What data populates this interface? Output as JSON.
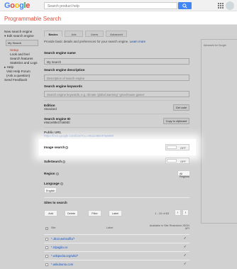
{
  "header": {
    "logo_letters": [
      {
        "ch": "G",
        "color": "#4285f4"
      },
      {
        "ch": "o",
        "color": "#ea4335"
      },
      {
        "ch": "o",
        "color": "#fbbc05"
      },
      {
        "ch": "g",
        "color": "#4285f4"
      },
      {
        "ch": "l",
        "color": "#34a853"
      },
      {
        "ch": "e",
        "color": "#ea4335"
      }
    ],
    "search_placeholder": "Search product help",
    "search_icon": "search-icon",
    "apps_icon": "apps-grid-icon"
  },
  "app_title": "Programmable Search",
  "sidebar": {
    "new_engine": "New search engine",
    "edit_engine": "▾ Edit search engine",
    "engine_select": "My Search",
    "items": [
      "Setup",
      "Look and feel",
      "Search features",
      "Statistics and Logs"
    ],
    "help": "▸ Help",
    "forum": "Visit Help Forum",
    "forum_sub": "(Ask a question)",
    "feedback": "Send Feedback"
  },
  "tabs": [
    "Basics",
    "Ads",
    "Users",
    "Advanced"
  ],
  "intro": {
    "text": "Provide basic details and preferences for your search engine.",
    "link": "Learn more"
  },
  "ad_panel_label": "Advanced for Google",
  "basics": {
    "name_label": "Search engine name",
    "name_value": "My Search",
    "desc_label": "Search engine description",
    "desc_placeholder": "Description of search engine",
    "keywords_label": "Search engine keywords",
    "keywords_placeholder": "Search engine keywords, e.g. climate 'global warming' 'greenhouse gases'",
    "edition_label": "Edition",
    "edition_value": "Standard",
    "get_code": "Get code",
    "id_label": "Search engine ID",
    "id_value": "e9a1e88e37a6650",
    "copy_clipboard": "Copy to clipboard",
    "public_url_label": "Public URL",
    "public_url_value": "https://cse.google.com/cse?cx=e9a1e88e37a6650",
    "image_search_label": "Image search",
    "image_search_state": "OFF",
    "safesearch_label": "SafeSearch",
    "safesearch_state": "OFF",
    "region_label": "Region",
    "region_value": "All Regions",
    "language_label": "Language",
    "language_value": "English",
    "sites_label": "Sites to search"
  },
  "sites": {
    "buttons": [
      "Add",
      "Delete",
      "Filter",
      "Label"
    ],
    "pager": "1 - 10 of 83",
    "col_site": "Site",
    "col_label": "Label",
    "col_available": "Available in Site Restricted JSON API",
    "rows": [
      "*.Jb13.websuffix/*",
      "*.Slpaglia.co",
      "*.wikipedia.org/wiki/*",
      "*.askubuntu.com"
    ]
  },
  "accent_color": "#dd4b39",
  "link_color": "#1155cc"
}
